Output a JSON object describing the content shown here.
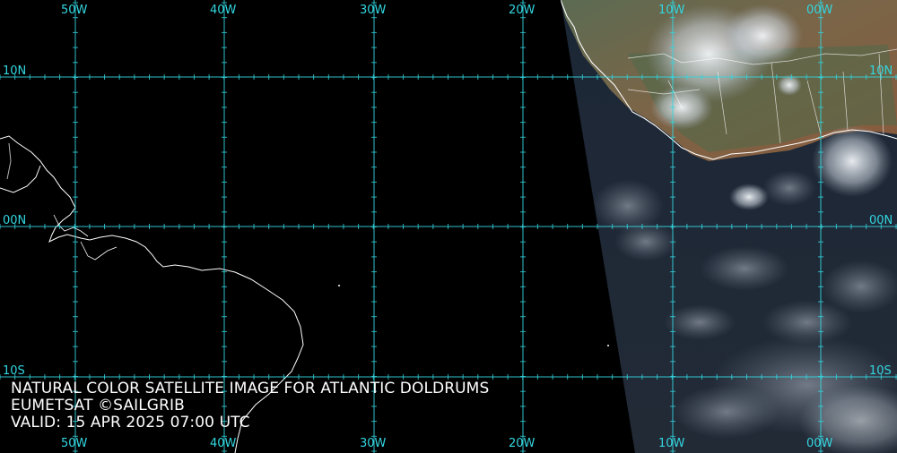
{
  "map": {
    "caption": {
      "title": "NATURAL COLOR SATELLITE IMAGE FOR ATLANTIC DOLDRUMS",
      "credit": "EUMETSAT ©SAILGRIB",
      "valid": "VALID:  15 APR 2025 07:00 UTC"
    },
    "longitude_labels": [
      "50W",
      "40W",
      "30W",
      "20W",
      "10W",
      "00W"
    ],
    "latitude_labels": [
      "10N",
      "00N",
      "10S"
    ],
    "colors": {
      "grid": "#33d6e0",
      "coastline": "#ffffff",
      "ocean_night": "#000000",
      "ocean_day": "#1e2a3a",
      "land_day": "#6b5a44",
      "cloud": "#e6ecf2"
    }
  }
}
